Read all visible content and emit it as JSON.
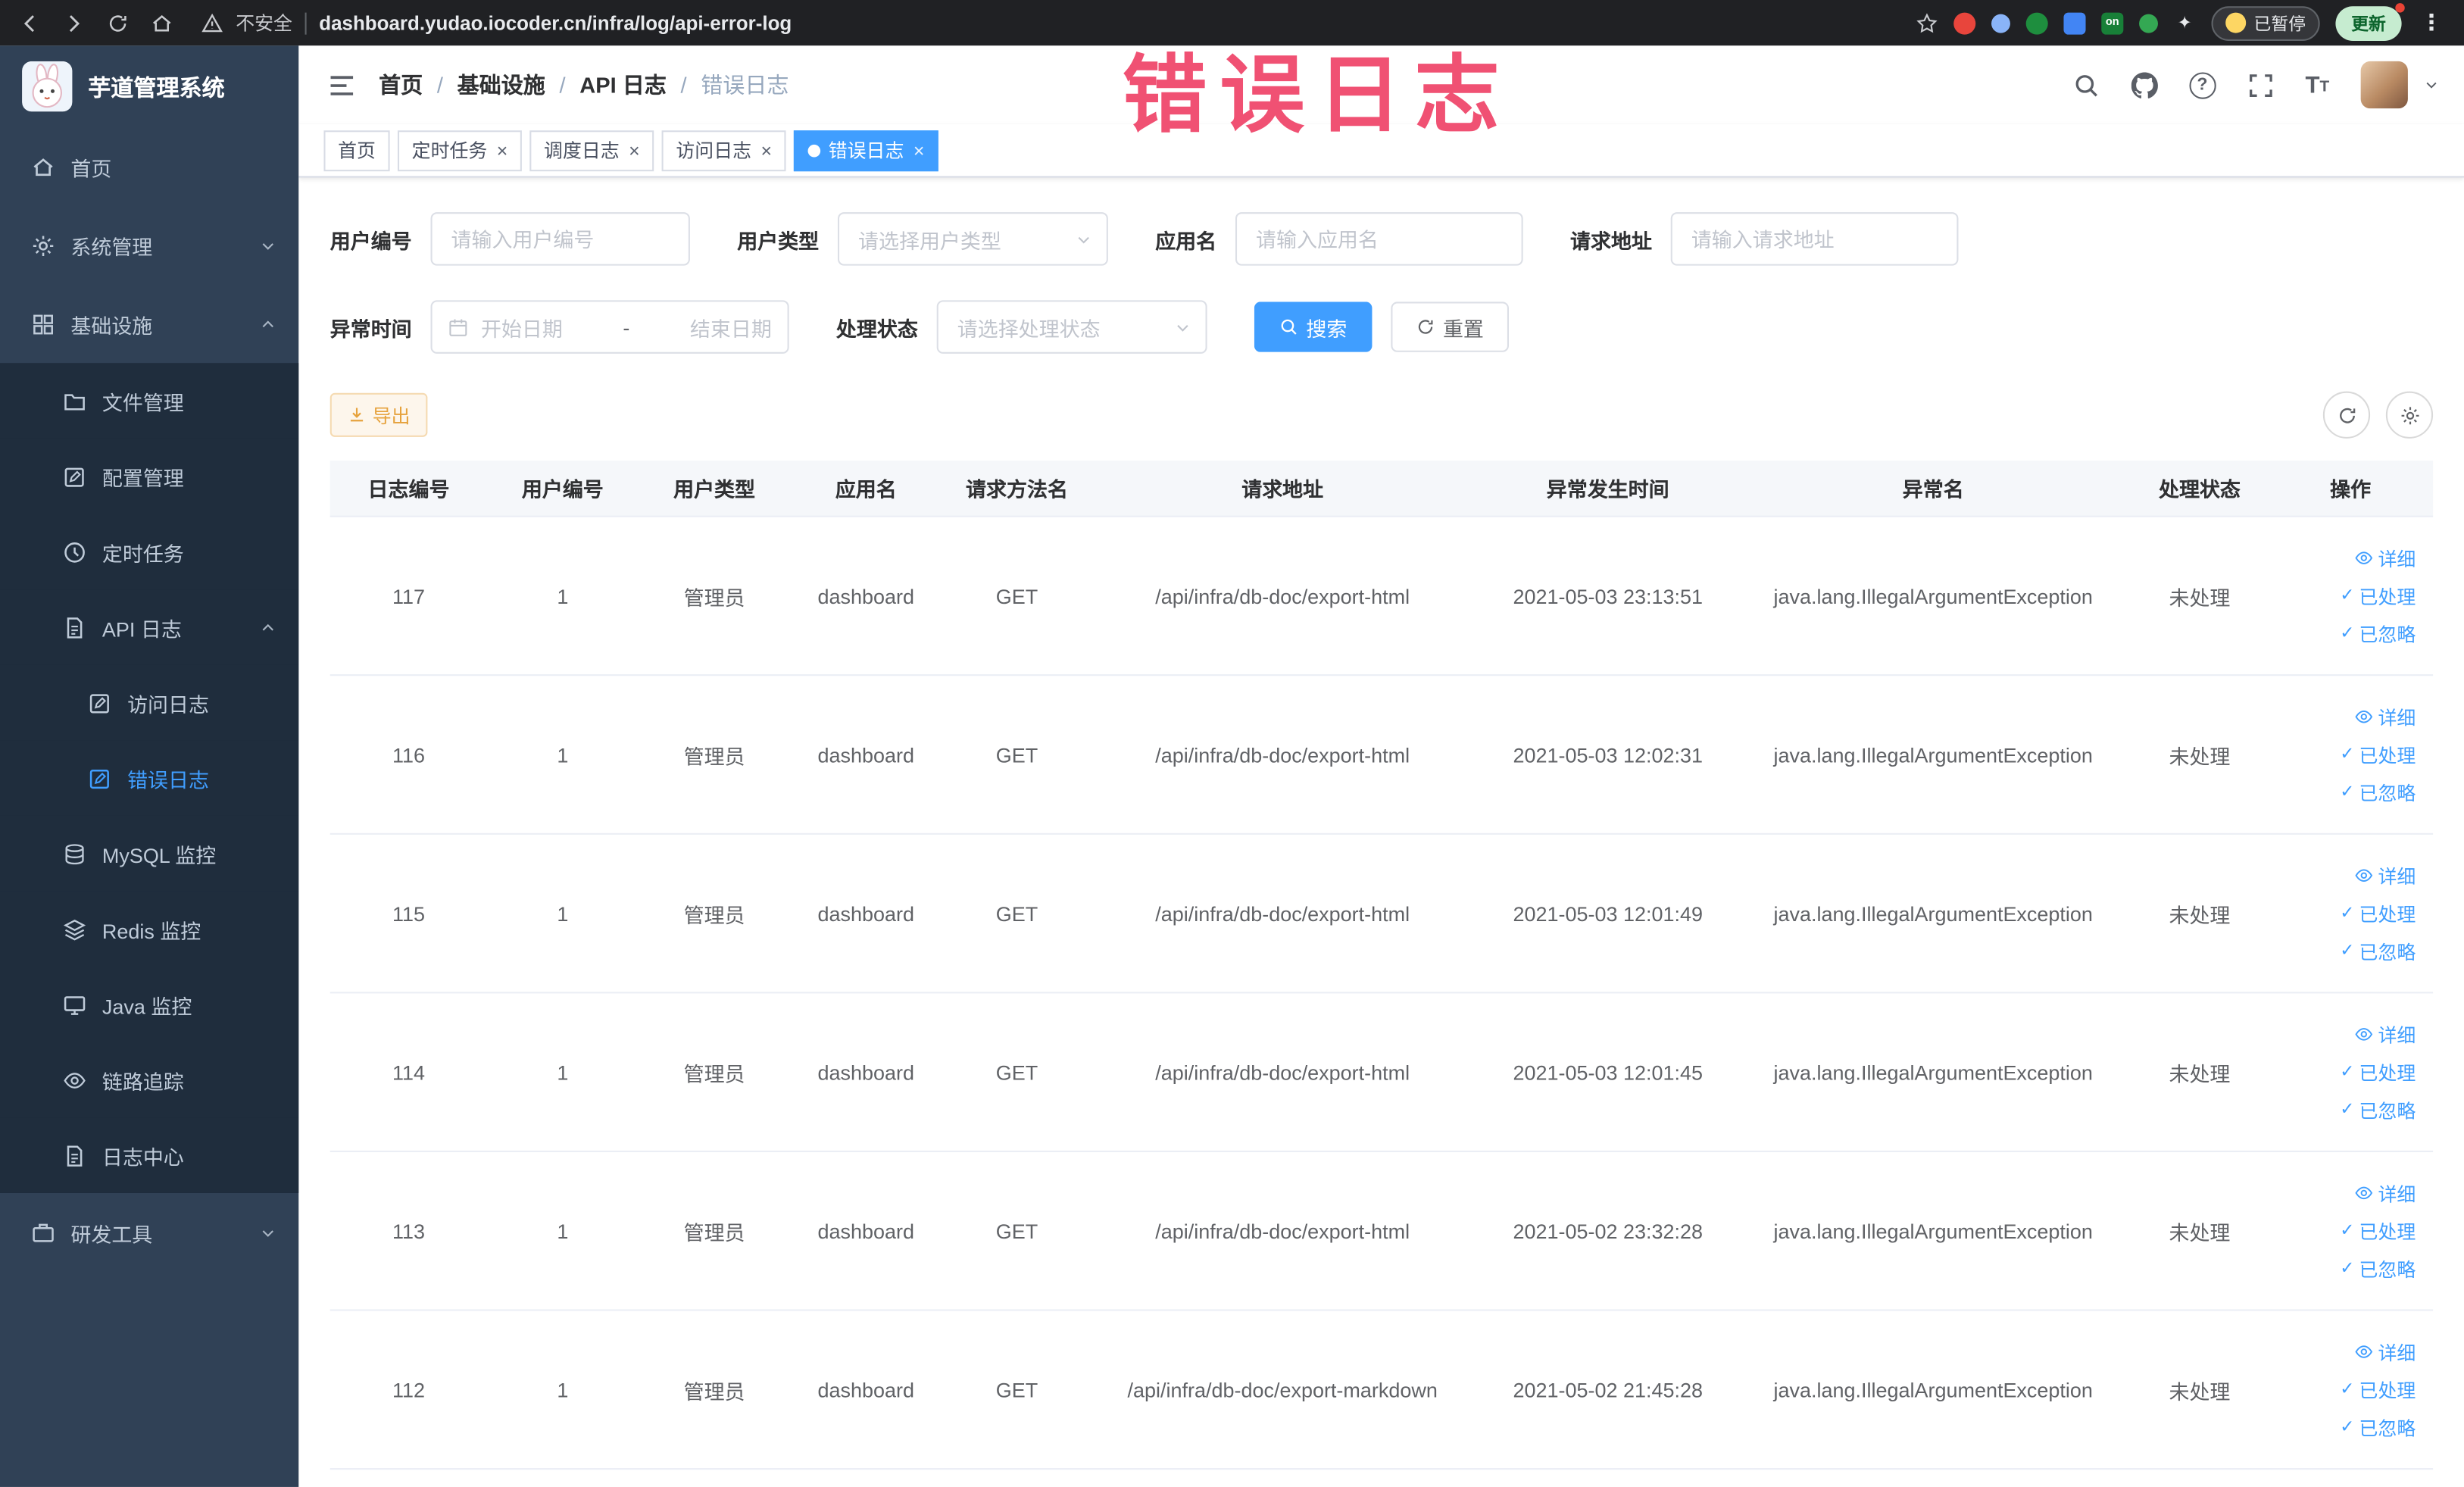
{
  "colors": {
    "accent": "#409eff",
    "annotation": "#f0486c",
    "sidebar_bg": "#304156"
  },
  "browser": {
    "security_label": "不安全",
    "url": "dashboard.yudao.iocoder.cn/infra/log/api-error-log",
    "paused_badge": "已暂停",
    "update_label": "更新"
  },
  "annotation": {
    "text": "错误日志"
  },
  "sidebar": {
    "logo_title": "芋道管理系统",
    "items": {
      "home": "首页",
      "system": "系统管理",
      "infra": "基础设施",
      "file": "文件管理",
      "config": "配置管理",
      "job": "定时任务",
      "api_log": "API 日志",
      "access_log": "访问日志",
      "error_log": "错误日志",
      "mysql": "MySQL 监控",
      "redis": "Redis 监控",
      "java": "Java 监控",
      "trace": "链路追踪",
      "log_center": "日志中心",
      "dev_tools": "研发工具"
    }
  },
  "breadcrumb": {
    "items": [
      "首页",
      "基础设施",
      "API 日志",
      "错误日志"
    ]
  },
  "tabs": [
    {
      "label": "首页",
      "active": false,
      "closable": false
    },
    {
      "label": "定时任务",
      "active": false,
      "closable": true
    },
    {
      "label": "调度日志",
      "active": false,
      "closable": true
    },
    {
      "label": "访问日志",
      "active": false,
      "closable": true
    },
    {
      "label": "错误日志",
      "active": true,
      "closable": true
    }
  ],
  "filters": {
    "user_id_label": "用户编号",
    "user_id_placeholder": "请输入用户编号",
    "user_type_label": "用户类型",
    "user_type_placeholder": "请选择用户类型",
    "app_name_label": "应用名",
    "app_name_placeholder": "请输入应用名",
    "request_url_label": "请求地址",
    "request_url_placeholder": "请输入请求地址",
    "exception_time_label": "异常时间",
    "date_start_placeholder": "开始日期",
    "date_separator": "-",
    "date_end_placeholder": "结束日期",
    "process_status_label": "处理状态",
    "process_status_placeholder": "请选择处理状态",
    "search_button": "搜索",
    "reset_button": "重置"
  },
  "toolbar": {
    "export_button": "导出"
  },
  "table": {
    "columns": [
      "日志编号",
      "用户编号",
      "用户类型",
      "应用名",
      "请求方法名",
      "请求地址",
      "异常发生时间",
      "异常名",
      "处理状态",
      "操作"
    ],
    "actions": [
      "详细",
      "已处理",
      "已忽略"
    ],
    "rows": [
      {
        "id": "117",
        "user_id": "1",
        "user_type": "管理员",
        "app": "dashboard",
        "method": "GET",
        "url": "/api/infra/db-doc/export-html",
        "time": "2021-05-03 23:13:51",
        "exception": "java.lang.IllegalArgumentException",
        "status": "未处理"
      },
      {
        "id": "116",
        "user_id": "1",
        "user_type": "管理员",
        "app": "dashboard",
        "method": "GET",
        "url": "/api/infra/db-doc/export-html",
        "time": "2021-05-03 12:02:31",
        "exception": "java.lang.IllegalArgumentException",
        "status": "未处理"
      },
      {
        "id": "115",
        "user_id": "1",
        "user_type": "管理员",
        "app": "dashboard",
        "method": "GET",
        "url": "/api/infra/db-doc/export-html",
        "time": "2021-05-03 12:01:49",
        "exception": "java.lang.IllegalArgumentException",
        "status": "未处理"
      },
      {
        "id": "114",
        "user_id": "1",
        "user_type": "管理员",
        "app": "dashboard",
        "method": "GET",
        "url": "/api/infra/db-doc/export-html",
        "time": "2021-05-03 12:01:45",
        "exception": "java.lang.IllegalArgumentException",
        "status": "未处理"
      },
      {
        "id": "113",
        "user_id": "1",
        "user_type": "管理员",
        "app": "dashboard",
        "method": "GET",
        "url": "/api/infra/db-doc/export-html",
        "time": "2021-05-02 23:32:28",
        "exception": "java.lang.IllegalArgumentException",
        "status": "未处理"
      },
      {
        "id": "112",
        "user_id": "1",
        "user_type": "管理员",
        "app": "dashboard",
        "method": "GET",
        "url": "/api/infra/db-doc/export-markdown",
        "time": "2021-05-02 21:45:28",
        "exception": "java.lang.IllegalArgumentException",
        "status": "未处理"
      }
    ]
  }
}
